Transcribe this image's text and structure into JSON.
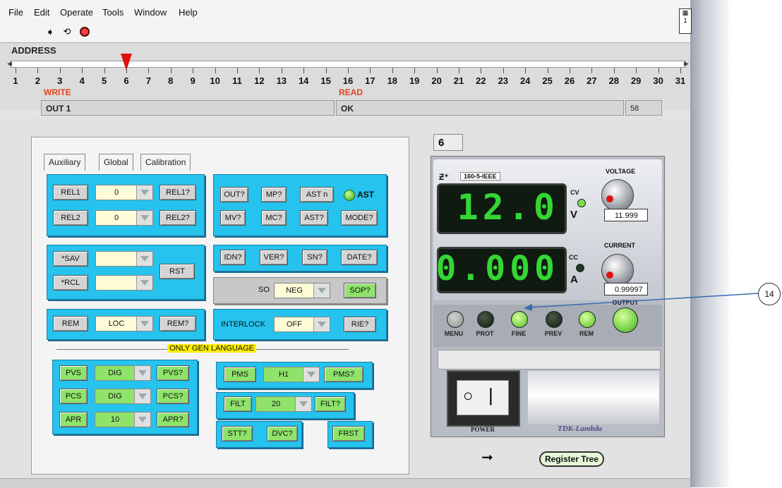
{
  "menu": [
    "File",
    "Edit",
    "Operate",
    "Tools",
    "Window",
    "Help"
  ],
  "toolbar_icons": [
    "run-arrow-icon",
    "run-continuous-icon",
    "abort-stop-icon"
  ],
  "address": {
    "label": "ADDRESS",
    "ticks": [
      "1",
      "2",
      "3",
      "4",
      "5",
      "6",
      "7",
      "8",
      "9",
      "10",
      "11",
      "12",
      "13",
      "14",
      "15",
      "16",
      "17",
      "18",
      "19",
      "20",
      "21",
      "22",
      "23",
      "24",
      "25",
      "26",
      "27",
      "28",
      "29",
      "30",
      "31"
    ],
    "value": 6
  },
  "write": {
    "label": "WRITE",
    "value": "OUT 1"
  },
  "read": {
    "label": "READ",
    "value": "OK",
    "count": "58"
  },
  "address_display": "6",
  "tabs": [
    "Auxiliary",
    "Global",
    "Calibration"
  ],
  "aux": {
    "rel1": "REL1",
    "rel1_val": "0",
    "rel1q": "REL1?",
    "rel2": "REL2",
    "rel2_val": "0",
    "rel2q": "REL2?",
    "sav": "*SAV",
    "rcl": "*RCL",
    "rst": "RST",
    "rem": "REM",
    "rem_val": "LOC",
    "remq": "REM?"
  },
  "status": {
    "outq": "OUT?",
    "mpq": "MP?",
    "astn": "AST n",
    "ast_led": "AST",
    "mvq": "MV?",
    "mcq": "MC?",
    "astq": "AST?",
    "modeq": "MODE?",
    "idnq": "IDN?",
    "verq": "VER?",
    "snq": "SN?",
    "dateq": "DATE?",
    "so_label": "SO",
    "so_val": "NEG",
    "sopq": "SOP?",
    "interlock_label": "INTERLOCK",
    "interlock_val": "OFF",
    "rieq": "RIE?"
  },
  "gen": {
    "title": "ONLY GEN LANGUAGE",
    "pvs": "PVS",
    "pvs_val": "DIG",
    "pvsq": "PVS?",
    "pcs": "PCS",
    "pcs_val": "DIG",
    "pcsq": "PCS?",
    "apr": "APR",
    "apr_val": "10",
    "aprq": "APR?",
    "pms": "PMS",
    "pms_val": "H1",
    "pmsq": "PMS?",
    "filt": "FILT",
    "filt_val": "20",
    "filtq": "FILT?",
    "sttq": "STT?",
    "dvcq": "DVC?",
    "frst": "FRST"
  },
  "device": {
    "model": "160-5-IEEE",
    "voltage_label": "VOLTAGE",
    "voltage_display": "12.0",
    "voltage_set": "11.999",
    "current_label": "CURRENT",
    "current_display": "0.000",
    "current_set": "0.99997",
    "cv": "CV",
    "v_unit": "V",
    "cc": "CC",
    "a_unit": "A",
    "output_label": "OUTPUT",
    "buttons": [
      "MENU",
      "PROT",
      "FINE",
      "PREV",
      "REM"
    ],
    "power_label": "POWER",
    "brand": "TDK-Lambda"
  },
  "callout": "14",
  "register_tree": "Register Tree",
  "colors": {
    "panel_blue": "#25c3ee",
    "led_green": "#8fe36a",
    "slider_red": "#e01010"
  }
}
